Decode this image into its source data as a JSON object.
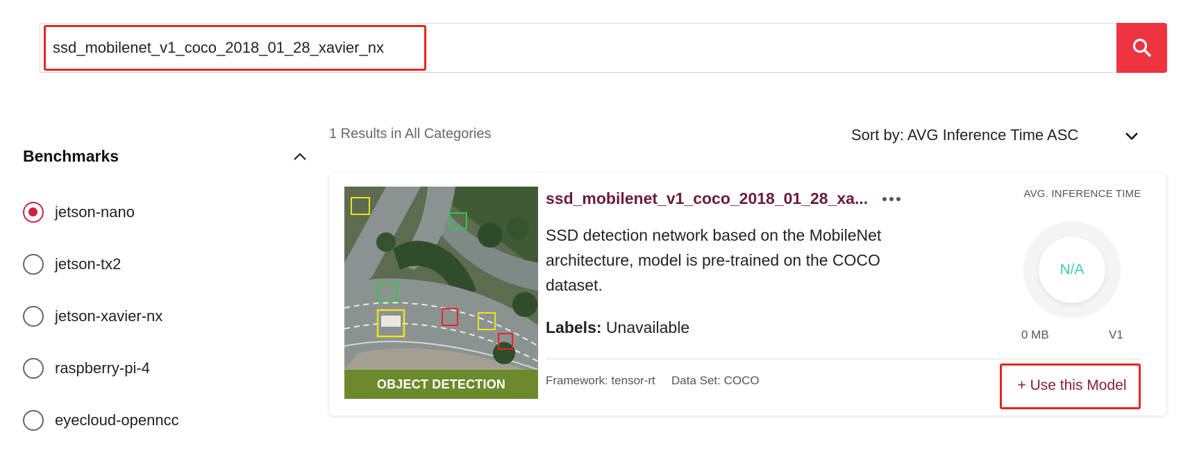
{
  "search": {
    "value": "ssd_mobilenet_v1_coco_2018_01_28_xavier_nx",
    "button_icon": "search-icon",
    "accent_color": "#ee3341"
  },
  "sidebar": {
    "title": "Benchmarks",
    "collapse_icon": "chevron-up-icon",
    "items": [
      {
        "label": "jetson-nano",
        "checked": true
      },
      {
        "label": "jetson-tx2",
        "checked": false
      },
      {
        "label": "jetson-xavier-nx",
        "checked": false
      },
      {
        "label": "raspberry-pi-4",
        "checked": false
      },
      {
        "label": "eyecloud-openncc",
        "checked": false
      }
    ]
  },
  "results": {
    "count_text": "1 Results in All Categories",
    "sort_text": "Sort by: AVG Inference Time ASC",
    "sort_icon": "chevron-down-icon"
  },
  "card": {
    "category_banner": "OBJECT DETECTION",
    "name": "ssd_mobilenet_v1_coco_2018_01_28_xa...",
    "more_icon": "more-horizontal-icon",
    "description": "SSD detection network based on the MobileNet architecture, model is pre-trained on the COCO dataset.",
    "labels_key": "Labels:",
    "labels_value": "Unavailable",
    "framework": "Framework: tensor-rt",
    "dataset": "Data Set: COCO",
    "avg_title": "AVG. INFERENCE TIME",
    "avg_value": "N/A",
    "size": "0 MB",
    "version": "V1",
    "use_button": "+ Use this Model",
    "name_color": "#6b1b3b",
    "avg_value_color": "#3ccfb0"
  }
}
